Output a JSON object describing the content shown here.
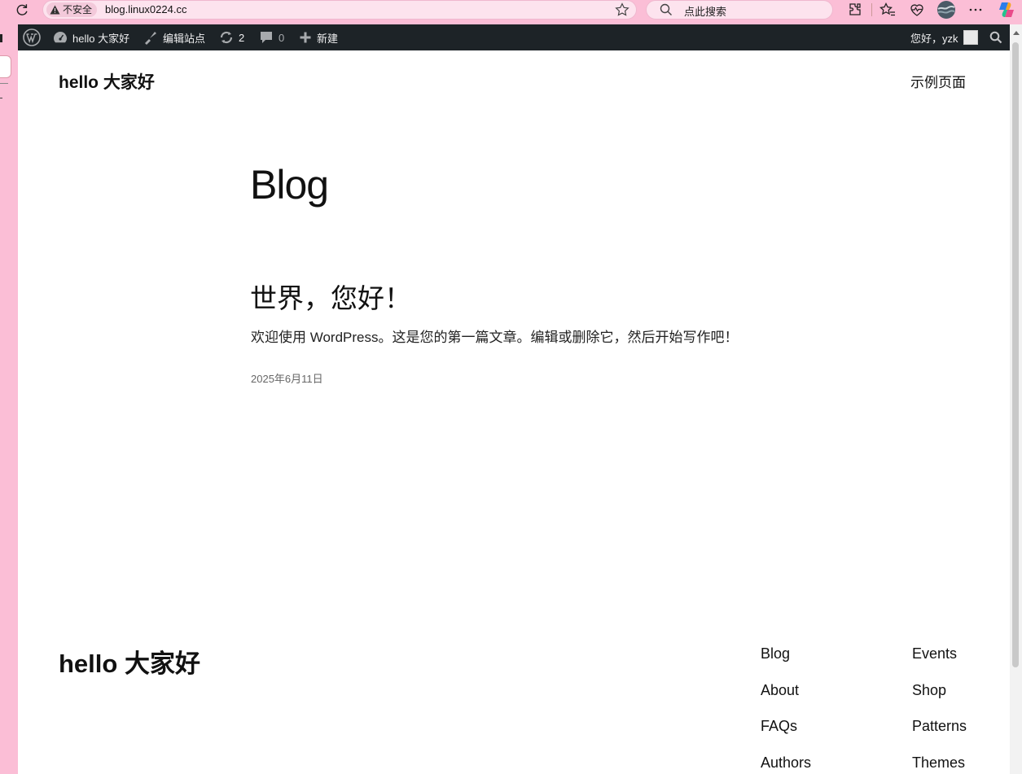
{
  "browser": {
    "insecure_label": "不安全",
    "url": "blog.linux0224.cc",
    "search_placeholder": "点此搜索"
  },
  "admin_bar": {
    "site_name": "hello 大家好",
    "edit_site": "编辑站点",
    "updates_count": "2",
    "comments_count": "0",
    "new_label": "新建",
    "greeting": "您好，yzk"
  },
  "header": {
    "site_title": "hello 大家好",
    "nav": [
      "示例页面"
    ]
  },
  "main": {
    "heading": "Blog",
    "posts": [
      {
        "title": "世界，您好！",
        "excerpt": "欢迎使用 WordPress。这是您的第一篇文章。编辑或删除它，然后开始写作吧！",
        "date": "2025年6月11日"
      }
    ]
  },
  "footer": {
    "site_title": "hello 大家好",
    "col1": [
      "Blog",
      "About",
      "FAQs",
      "Authors"
    ],
    "col2": [
      "Events",
      "Shop",
      "Patterns",
      "Themes"
    ]
  }
}
